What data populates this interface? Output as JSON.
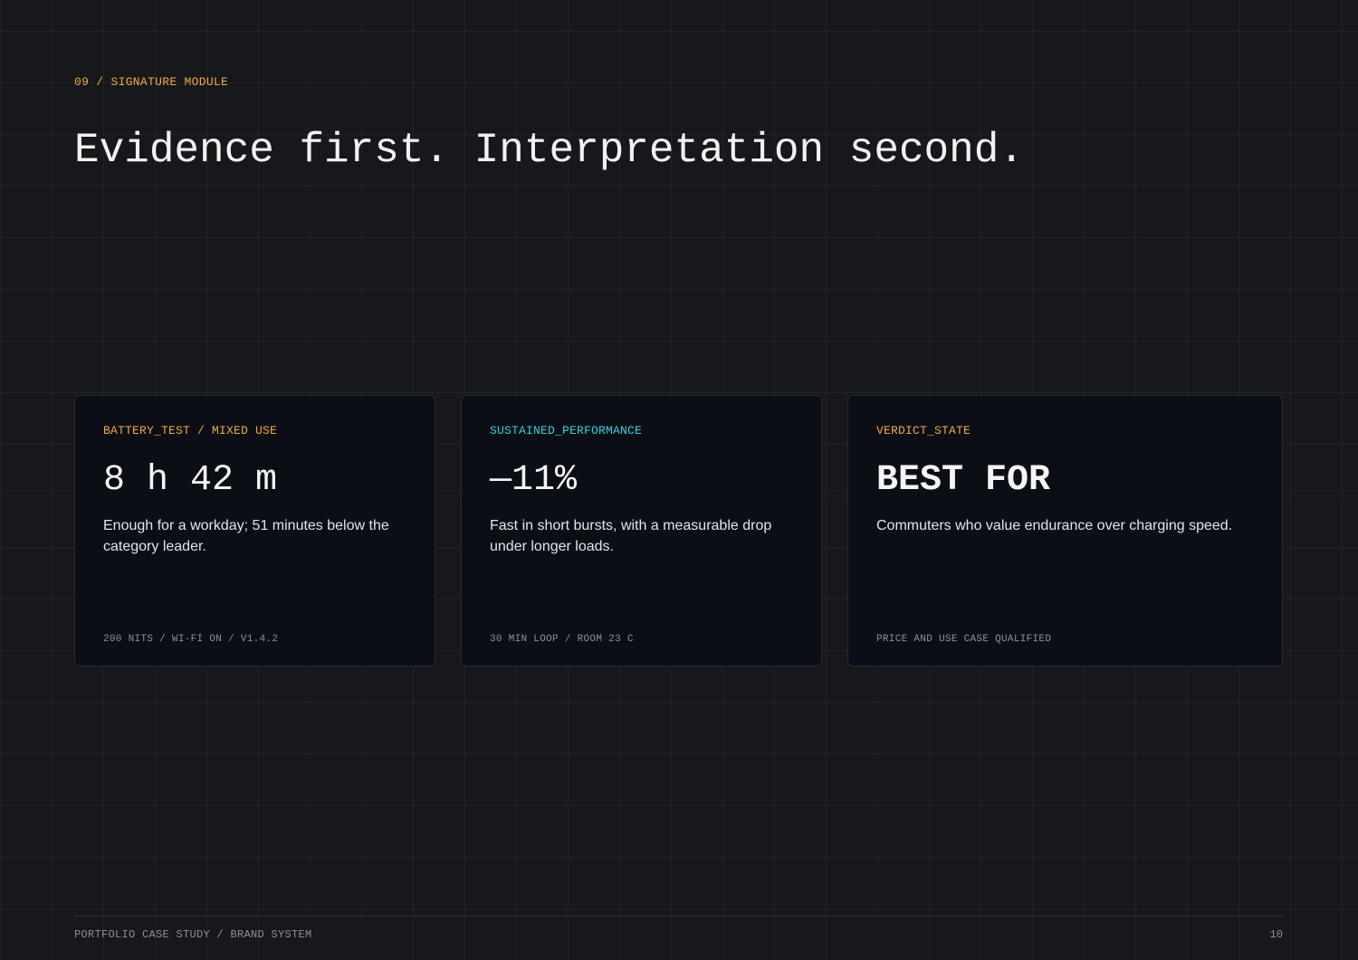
{
  "header": {
    "eyebrow": "09 / SIGNATURE MODULE",
    "headline": "Evidence first. Interpretation second."
  },
  "cards": [
    {
      "label": "BATTERY_TEST / MIXED USE",
      "value": "8 h 42 m",
      "description": "Enough for a workday; 51 minutes below the category leader.",
      "meta": "200 NITS / WI-FI ON / V1.4.2",
      "label_color": "#f2a93b"
    },
    {
      "label": "SUSTAINED_PERFORMANCE",
      "value": "—11%",
      "description": "Fast in short bursts, with a measurable drop under longer loads.",
      "meta": "30 MIN LOOP / ROOM 23 C",
      "label_color": "#2fd4e0"
    },
    {
      "label": "VERDICT_STATE",
      "value": "BEST FOR",
      "description": "Commuters who value endurance over charging speed.",
      "meta": "PRICE AND USE CASE QUALIFIED",
      "label_color": "#f2a93b"
    }
  ],
  "footer": {
    "left": "PORTFOLIO CASE STUDY / BRAND SYSTEM",
    "page_number": "10"
  },
  "colors": {
    "background": "#17181c",
    "card_background": "#0b0e15",
    "accent_amber": "#f2a93b",
    "accent_cyan": "#2fd4e0"
  }
}
